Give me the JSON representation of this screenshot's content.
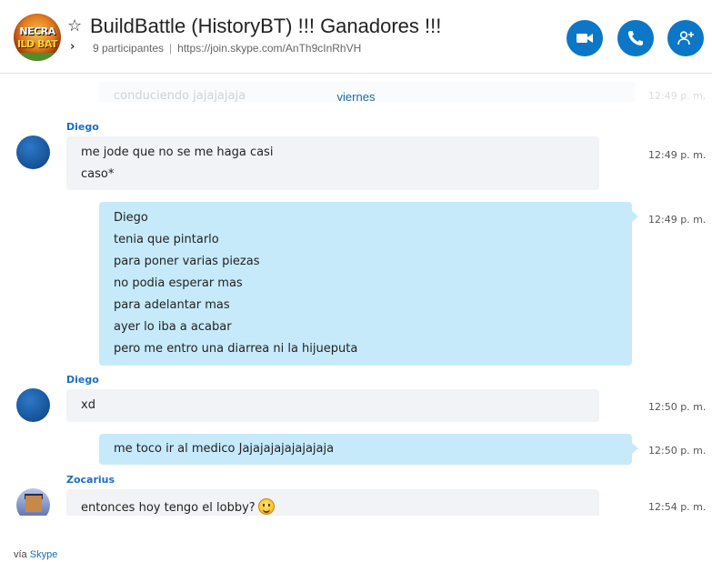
{
  "header": {
    "logo_top": "NECRA",
    "logo_bottom": "ILD BAT",
    "title": "BuildBattle (HistoryBT) !!! Ganadores !!!",
    "participants": "9 participantes",
    "join_link": "https://join.skype.com/AnTh9cInRhVH",
    "buttons": [
      "video-call",
      "audio-call",
      "add-participant"
    ]
  },
  "chat": {
    "faded_prev_text": "conduciendo jajajajaja",
    "faded_prev_time": "12:49 p. m.",
    "day_label": "viernes",
    "messages": [
      {
        "sender": "Diego",
        "direction": "in",
        "lines": [
          "me jode que no se me haga casi",
          "caso*"
        ],
        "time": "12:49 p. m."
      },
      {
        "direction": "out",
        "lines": [
          "Diego",
          "tenia que pintarlo",
          "para poner varias piezas",
          "no podia esperar mas",
          "para adelantar mas",
          "ayer lo iba a acabar",
          "pero me entro una diarrea ni la hijueputa"
        ],
        "time": "12:49 p. m."
      },
      {
        "sender": "Diego",
        "direction": "in",
        "lines": [
          "xd"
        ],
        "time": "12:50 p. m."
      },
      {
        "direction": "out",
        "lines": [
          "me toco ir al medico Jajajajajajajajaja"
        ],
        "time": "12:50 p. m."
      },
      {
        "sender": "Zocarius",
        "direction": "in",
        "lines": [
          "entonces hoy tengo el lobby?"
        ],
        "emoji": "smiley",
        "time": "12:54 p. m."
      }
    ]
  },
  "footer": {
    "via": "vía",
    "brand": "Skype"
  },
  "colors": {
    "accent": "#0b77c6",
    "incoming_bubble": "#f1f3f6",
    "outgoing_bubble": "#c6eafa",
    "sender_name": "#1b6ec2"
  }
}
